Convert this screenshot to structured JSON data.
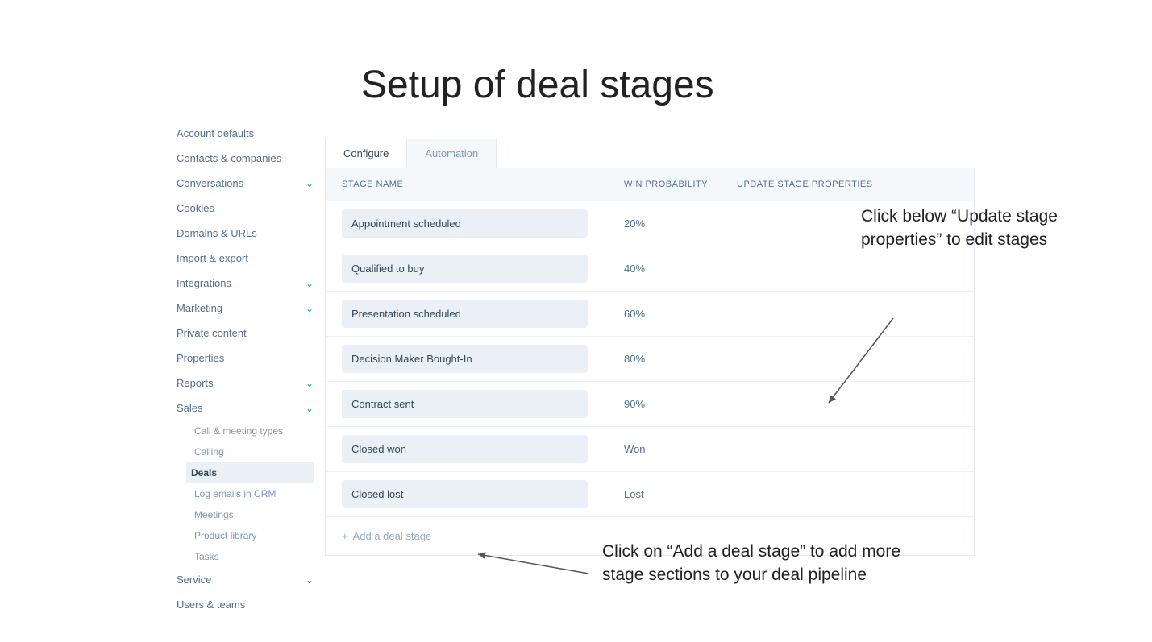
{
  "title": "Setup of deal stages",
  "sidebar": {
    "items": [
      {
        "label": "Account defaults",
        "expandable": false
      },
      {
        "label": "Contacts & companies",
        "expandable": false
      },
      {
        "label": "Conversations",
        "expandable": true
      },
      {
        "label": "Cookies",
        "expandable": false
      },
      {
        "label": "Domains & URLs",
        "expandable": false
      },
      {
        "label": "Import & export",
        "expandable": false
      },
      {
        "label": "Integrations",
        "expandable": true
      },
      {
        "label": "Marketing",
        "expandable": true
      },
      {
        "label": "Private content",
        "expandable": false
      },
      {
        "label": "Properties",
        "expandable": false
      },
      {
        "label": "Reports",
        "expandable": true
      },
      {
        "label": "Sales",
        "expandable": true,
        "expanded": true
      },
      {
        "label": "Service",
        "expandable": true
      },
      {
        "label": "Users & teams",
        "expandable": false
      }
    ],
    "sales_children": [
      {
        "label": "Call & meeting types",
        "active": false
      },
      {
        "label": "Calling",
        "active": false
      },
      {
        "label": "Deals",
        "active": true
      },
      {
        "label": "Log emails in CRM",
        "active": false
      },
      {
        "label": "Meetings",
        "active": false
      },
      {
        "label": "Product library",
        "active": false
      },
      {
        "label": "Tasks",
        "active": false
      }
    ]
  },
  "tabs": {
    "configure": "Configure",
    "automation": "Automation"
  },
  "columns": {
    "name": "STAGE NAME",
    "prob": "WIN PROBABILITY",
    "update": "UPDATE STAGE PROPERTIES"
  },
  "stages": [
    {
      "name": "Appointment scheduled",
      "prob": "20%"
    },
    {
      "name": "Qualified to buy",
      "prob": "40%"
    },
    {
      "name": "Presentation scheduled",
      "prob": "60%"
    },
    {
      "name": "Decision Maker Bought-In",
      "prob": "80%"
    },
    {
      "name": "Contract sent",
      "prob": "90%"
    },
    {
      "name": "Closed won",
      "prob": "Won"
    },
    {
      "name": "Closed lost",
      "prob": "Lost"
    }
  ],
  "add_stage": "Add a deal stage",
  "callouts": {
    "c1": "Click below “Update stage properties” to edit stages",
    "c2": "Click on “Add a deal stage” to add more stage sections to your deal pipeline"
  }
}
